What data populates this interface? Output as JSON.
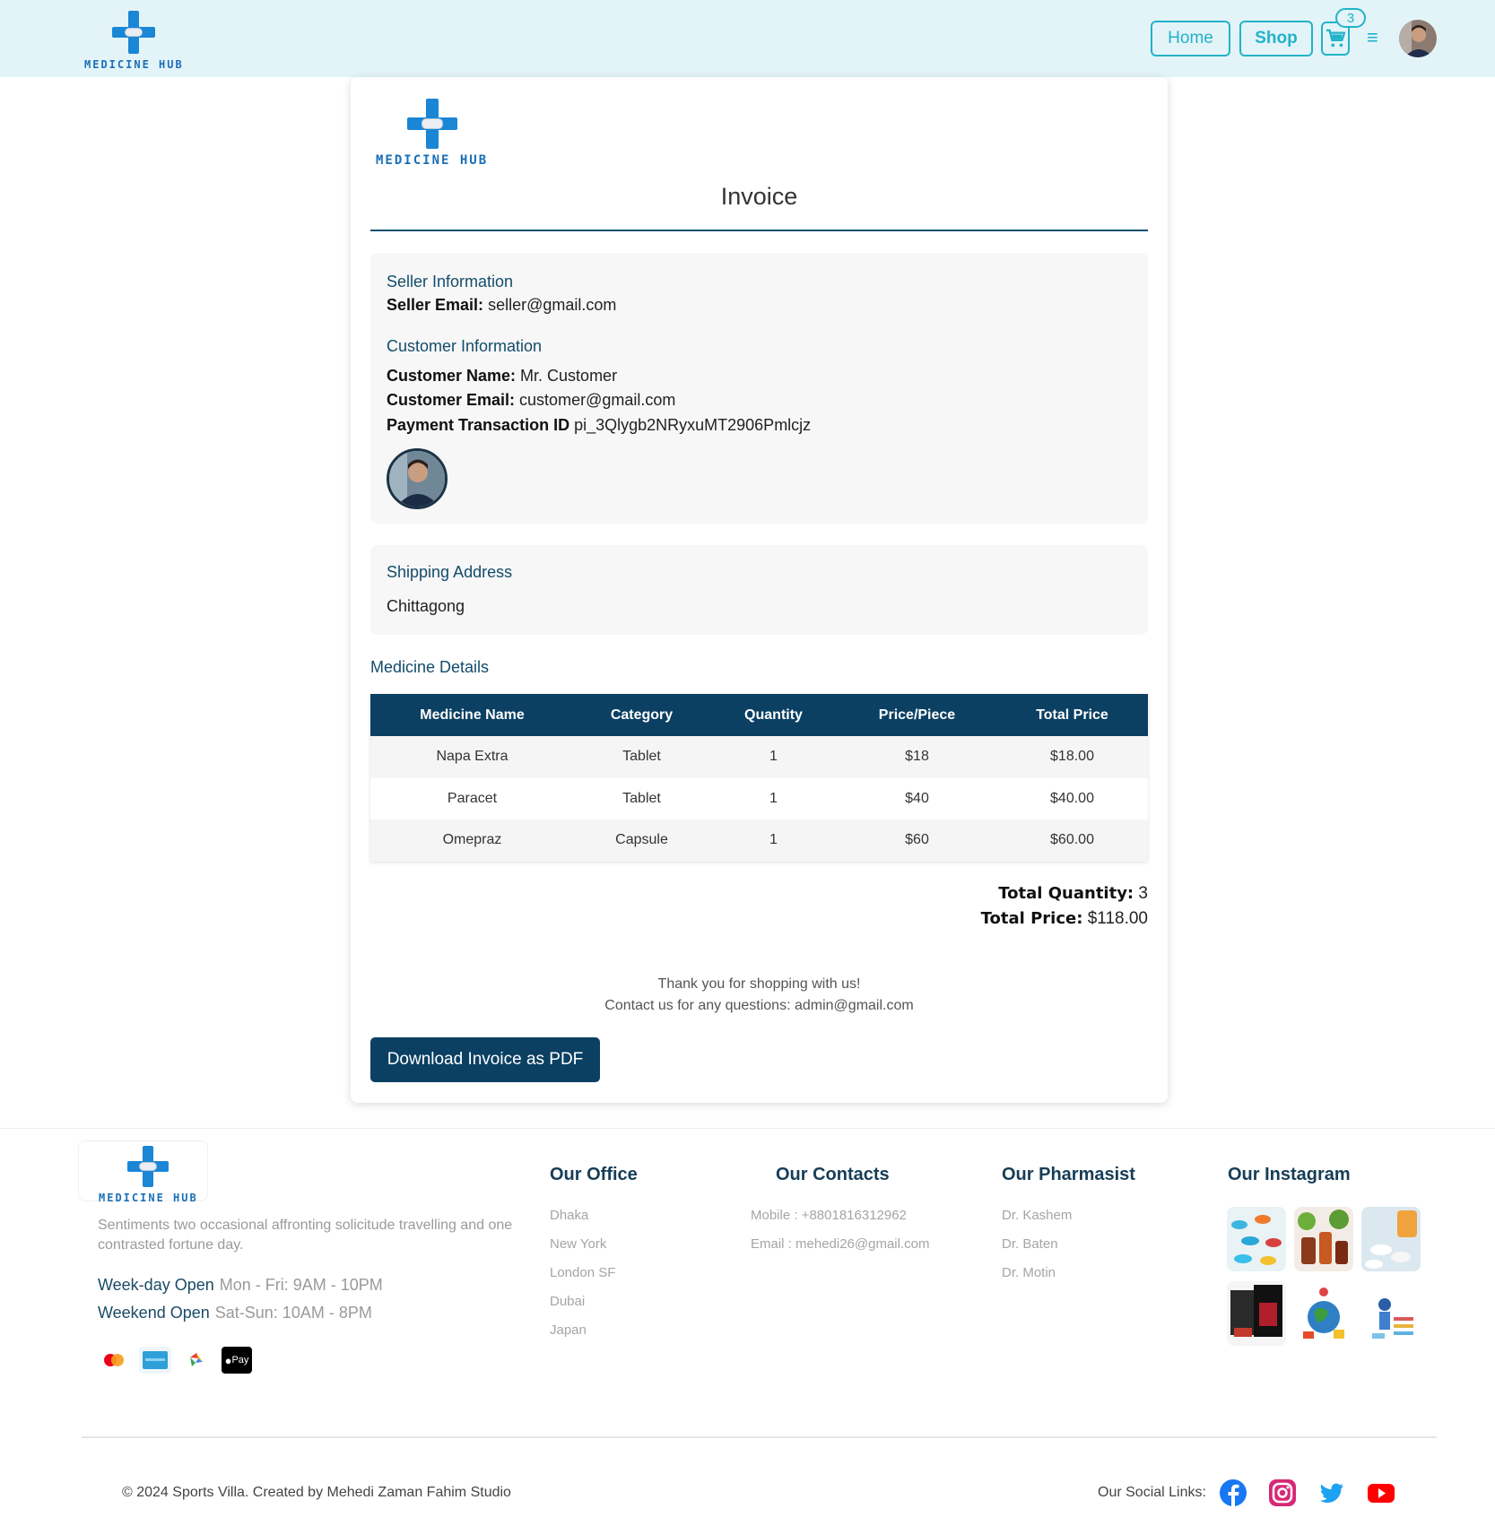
{
  "brand": {
    "logo_text": "MEDICINE HUB"
  },
  "nav": {
    "home_label": "Home",
    "shop_label": "Shop",
    "cart_count": "3",
    "menu_glyph": "≡"
  },
  "invoice": {
    "title": "Invoice",
    "seller": {
      "heading": "Seller Information",
      "email_label": "Seller Email:",
      "email": " seller@gmail.com"
    },
    "customer": {
      "heading": "Customer Information",
      "name_label": "Customer Name:",
      "name": " Mr. Customer",
      "email_label": "Customer Email:",
      "email": " customer@gmail.com",
      "txn_label": "Payment Transaction ID",
      "txn": " pi_3Qlygb2NRyxuMT2906Pmlcjz"
    },
    "shipping": {
      "heading": "Shipping Address",
      "address": "Chittagong"
    },
    "details_heading": "Medicine Details",
    "table": {
      "headers": [
        "Medicine Name",
        "Category",
        "Quantity",
        "Price/Piece",
        "Total Price"
      ],
      "rows": [
        [
          "Napa Extra",
          "Tablet",
          "1",
          "$18",
          "$18.00"
        ],
        [
          "Paracet",
          "Tablet",
          "1",
          "$40",
          "$40.00"
        ],
        [
          "Omepraz",
          "Capsule",
          "1",
          "$60",
          "$60.00"
        ]
      ]
    },
    "total_quantity_label": "Total Quantity:",
    "total_quantity": " 3",
    "total_price_label": "Total Price:",
    "total_price": " $118.00",
    "thanks": "Thank you for shopping with us!",
    "contact": "Contact us for any questions: admin@gmail.com",
    "download_label": "Download Invoice as PDF"
  },
  "footer": {
    "tagline": "Sentiments two occasional affronting solicitude travelling and one contrasted fortune day.",
    "weekday_label": "Week-day Open",
    "weekday_hours": "Mon - Fri: 9AM - 10PM",
    "weekend_label": "Weekend Open",
    "weekend_hours": "Sat-Sun: 10AM - 8PM",
    "office_heading": "Our Office",
    "offices": [
      "Dhaka",
      "New York",
      "London SF",
      "Dubai",
      "Japan"
    ],
    "contacts_heading": "Our Contacts",
    "mobile": "Mobile : +8801816312962",
    "email": "Email : mehedi26@gmail.com",
    "pharmacist_heading": "Our Pharmasist",
    "pharmacists": [
      "Dr. Kashem",
      "Dr. Baten",
      "Dr. Motin"
    ],
    "instagram_heading": "Our Instagram",
    "copyright": "© 2024 Sports Villa. Created by Mehedi Zaman Fahim Studio",
    "social_label": "Our Social Links:",
    "apple_pay_text": "Pay"
  },
  "colors": {
    "brand_blue": "#1a86d6",
    "accent_teal": "#22b3c9",
    "navy": "#0b4063",
    "header_bg": "#e3f4f8"
  }
}
